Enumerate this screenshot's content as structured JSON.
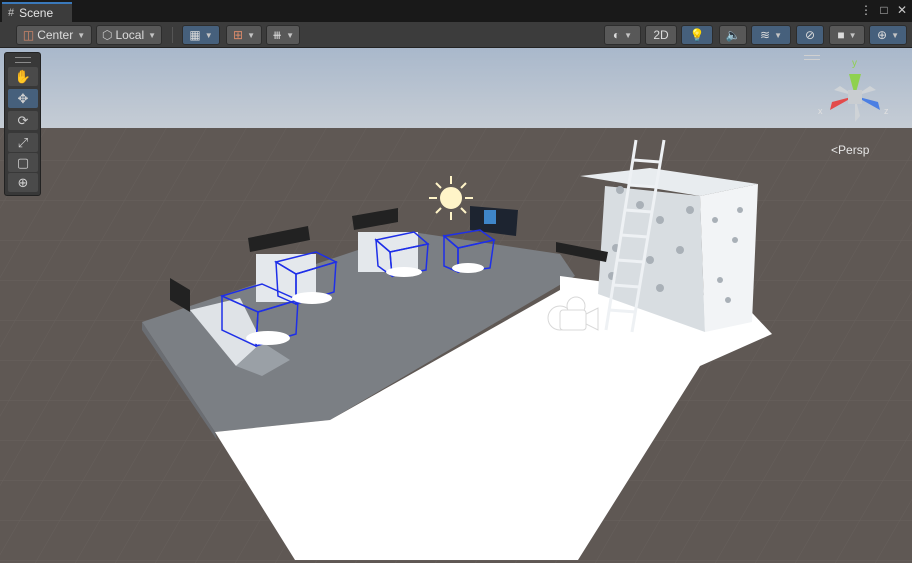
{
  "window": {
    "tab_title": "Scene",
    "tab_icon": "scene-grid-icon"
  },
  "toolbar": {
    "pivot_label": "Center",
    "space_label": "Local",
    "mode_2d_label": "2D"
  },
  "gizmo": {
    "axis_y": "y",
    "axis_x": "x",
    "axis_z": "z",
    "projection_label": "Persp"
  },
  "colors": {
    "accent": "#3a79bb",
    "toolbar_bg": "#3c3c3c",
    "active_button": "#46607c",
    "ground": "#5e5753",
    "platform": "#797d82",
    "white_floor": "#ffffff",
    "selection_wire": "#1e2fe8"
  }
}
